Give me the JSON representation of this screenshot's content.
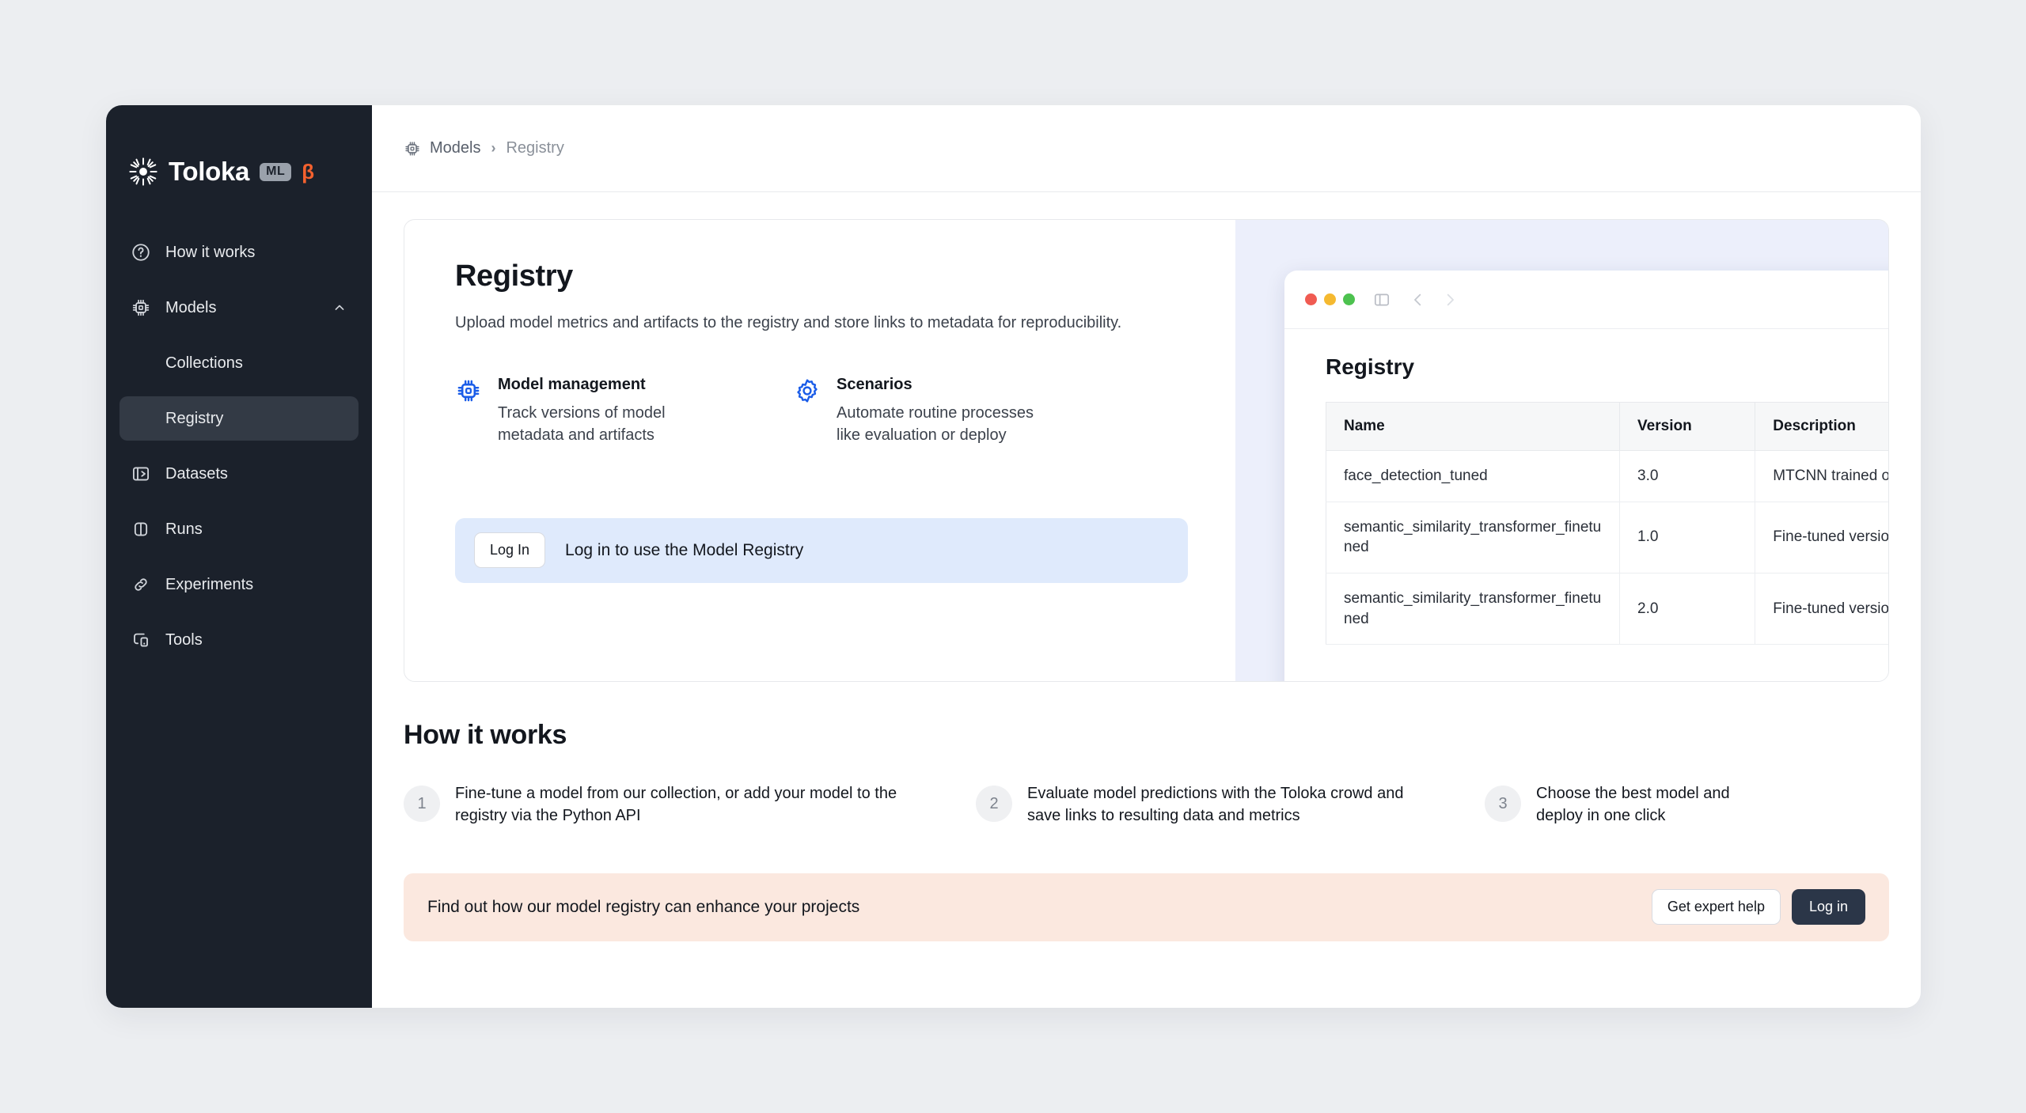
{
  "brand": {
    "name": "Toloka",
    "badge": "ML",
    "beta": "β",
    "logo_icon": "sunburst-icon"
  },
  "sidebar": {
    "items": [
      {
        "label": "How it works",
        "icon": "question-circle-icon",
        "active": false,
        "child": false
      },
      {
        "label": "Models",
        "icon": "cpu-chip-icon",
        "active": false,
        "child": false,
        "expanded": true
      },
      {
        "label": "Collections",
        "icon": "",
        "active": false,
        "child": true
      },
      {
        "label": "Registry",
        "icon": "",
        "active": true,
        "child": true
      },
      {
        "label": "Datasets",
        "icon": "datasets-icon",
        "active": false,
        "child": false
      },
      {
        "label": "Runs",
        "icon": "runs-icon",
        "active": false,
        "child": false
      },
      {
        "label": "Experiments",
        "icon": "experiments-icon",
        "active": false,
        "child": false
      },
      {
        "label": "Tools",
        "icon": "tools-icon",
        "active": false,
        "child": false
      }
    ]
  },
  "breadcrumb": {
    "icon": "cpu-chip-icon",
    "parent": "Models",
    "separator": "›",
    "current": "Registry"
  },
  "hero": {
    "title": "Registry",
    "subtitle": "Upload model metrics and artifacts to the registry and store links to metadata for reproducibility.",
    "features": [
      {
        "icon": "cpu-chip-icon",
        "title": "Model management",
        "desc": "Track versions of model metadata and artifacts"
      },
      {
        "icon": "gear-icon",
        "title": "Scenarios",
        "desc": "Automate routine processes like evaluation or deploy"
      }
    ],
    "login_banner": {
      "button_label": "Log In",
      "text": "Log in to use the Model Registry"
    }
  },
  "preview": {
    "window_controls": [
      "close-dot",
      "minimize-dot",
      "maximize-dot"
    ],
    "sidebar_toggle_icon": "panel-toggle-icon",
    "back_icon": "chevron-left-icon",
    "forward_icon": "chevron-right-icon",
    "title": "Registry",
    "table": {
      "columns": [
        "Name",
        "Version",
        "Description"
      ],
      "rows": [
        [
          "face_detection_tuned",
          "3.0",
          "MTCNN trained on FACE and CelebA"
        ],
        [
          "semantic_similarity_transformer_finetuned",
          "1.0",
          "Fine-tuned version of Microsoft MPNet"
        ],
        [
          "semantic_similarity_transformer_finetuned",
          "2.0",
          "Fine-tuned version of Microsoft MPNet"
        ]
      ]
    }
  },
  "how_it_works": {
    "title": "How it works",
    "steps": [
      {
        "num": "1",
        "text": "Fine-tune a model from our collection, or add your model to the registry via the Python API"
      },
      {
        "num": "2",
        "text": "Evaluate model predictions with the Toloka crowd and save links to resulting data and metrics"
      },
      {
        "num": "3",
        "text": "Choose the best model and deploy in one click"
      }
    ]
  },
  "cta": {
    "text": "Find out how our model registry can enhance your projects",
    "secondary_label": "Get expert help",
    "primary_label": "Log in"
  },
  "colors": {
    "sidebar_bg": "#1b212b",
    "page_bg": "#eceef1",
    "accent_blue": "#1a5ce8",
    "beta_orange": "#f4612e",
    "login_banner_bg": "#dfeafc",
    "cta_bg": "#fbe8df",
    "cta_primary_bg": "#2b3648",
    "preview_bg": "#eceffb"
  }
}
